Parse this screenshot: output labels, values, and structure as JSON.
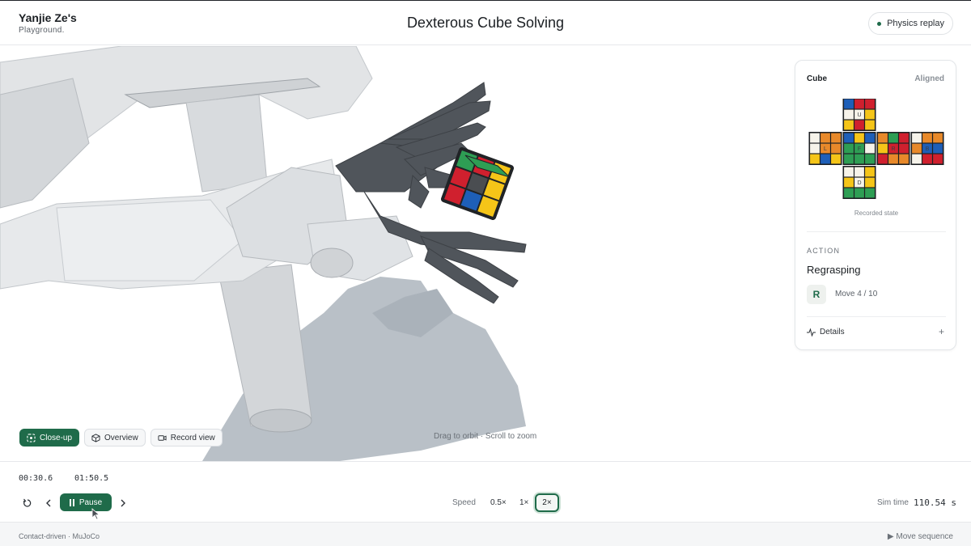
{
  "header": {
    "brand_name": "Yanjie Ze's",
    "brand_sub": "Playground.",
    "title": "Dexterous Cube Solving",
    "badge": "Physics replay"
  },
  "viewport": {
    "view_buttons": [
      {
        "label": "Close-up",
        "icon": "focus-icon",
        "active": true
      },
      {
        "label": "Overview",
        "icon": "cube-icon",
        "active": false
      },
      {
        "label": "Record view",
        "icon": "camera-icon",
        "active": false
      }
    ],
    "hint": "Drag to orbit · Scroll to zoom"
  },
  "panel": {
    "cube_title": "Cube",
    "cube_status": "Aligned",
    "cube_caption": "Recorded state",
    "faces": {
      "U": [
        "#1e5fb8",
        "#d0202e",
        "#d0202e",
        "#f6f3ea",
        "#f6f3ea",
        "#f5c518",
        "#f5c518",
        "#d0202e",
        "#f5c518"
      ],
      "L": [
        "#f6f3ea",
        "#e8892a",
        "#e8892a",
        "#f6f3ea",
        "#e8892a",
        "#e8892a",
        "#f5c518",
        "#1e5fb8",
        "#f5c518"
      ],
      "F": [
        "#1e5fb8",
        "#f5c518",
        "#1e5fb8",
        "#2e9e54",
        "#2e9e54",
        "#f6f3ea",
        "#2e9e54",
        "#2e9e54",
        "#2e9e54"
      ],
      "R": [
        "#e8892a",
        "#2e9e54",
        "#d0202e",
        "#f5c518",
        "#d0202e",
        "#d0202e",
        "#d0202e",
        "#e8892a",
        "#e8892a"
      ],
      "B": [
        "#f6f3ea",
        "#e8892a",
        "#e8892a",
        "#e8892a",
        "#1e5fb8",
        "#1e5fb8",
        "#f6f3ea",
        "#d0202e",
        "#d0202e"
      ],
      "D": [
        "#f6f3ea",
        "#f6f3ea",
        "#f5c518",
        "#f5c518",
        "#f6f3ea",
        "#f5c518",
        "#2e9e54",
        "#2e9e54",
        "#2e9e54"
      ]
    },
    "action_label": "ACTION",
    "action_name": "Regrasping",
    "move_letter": "R",
    "move_count": "Move 4 / 10",
    "details_label": "Details",
    "details_plus": "+"
  },
  "timeline": {
    "current_time": "00:30.6",
    "total_time": "01:50.5",
    "pause_label": "Pause",
    "speed_label": "Speed",
    "speeds": [
      "0.5×",
      "1×",
      "2×"
    ],
    "selected_speed": "2×",
    "sim_time_label": "Sim time",
    "sim_time_value": "110.54 s"
  },
  "footer": {
    "left": "Contact-driven · MuJoCo",
    "right": "▶ Move sequence"
  },
  "colors": {
    "accent": "#1f6b4a",
    "robot_body": "#e4e6e8",
    "hand": "#4d5258",
    "shadow": "#b6bcc3"
  }
}
